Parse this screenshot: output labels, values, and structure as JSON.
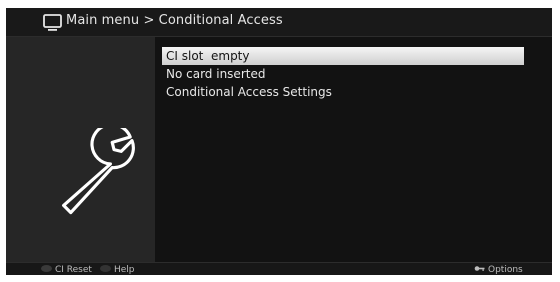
{
  "header": {
    "title": "Main menu > Conditional Access",
    "icon": "tv-icon"
  },
  "left_panel": {
    "icon": "wrench-icon"
  },
  "menu": {
    "items": [
      {
        "label": "CI slot  empty",
        "selected": true
      },
      {
        "label": "No card inserted",
        "selected": false
      },
      {
        "label": "Conditional Access Settings",
        "selected": false
      }
    ]
  },
  "footer": {
    "red_label": "CI Reset",
    "green_label": "Help",
    "options_label": "Options",
    "options_icon": "key-icon"
  },
  "colors": {
    "background": "#121212",
    "panel": "#262626",
    "highlight": "#e6e6e6",
    "text": "#e8e8e8"
  }
}
